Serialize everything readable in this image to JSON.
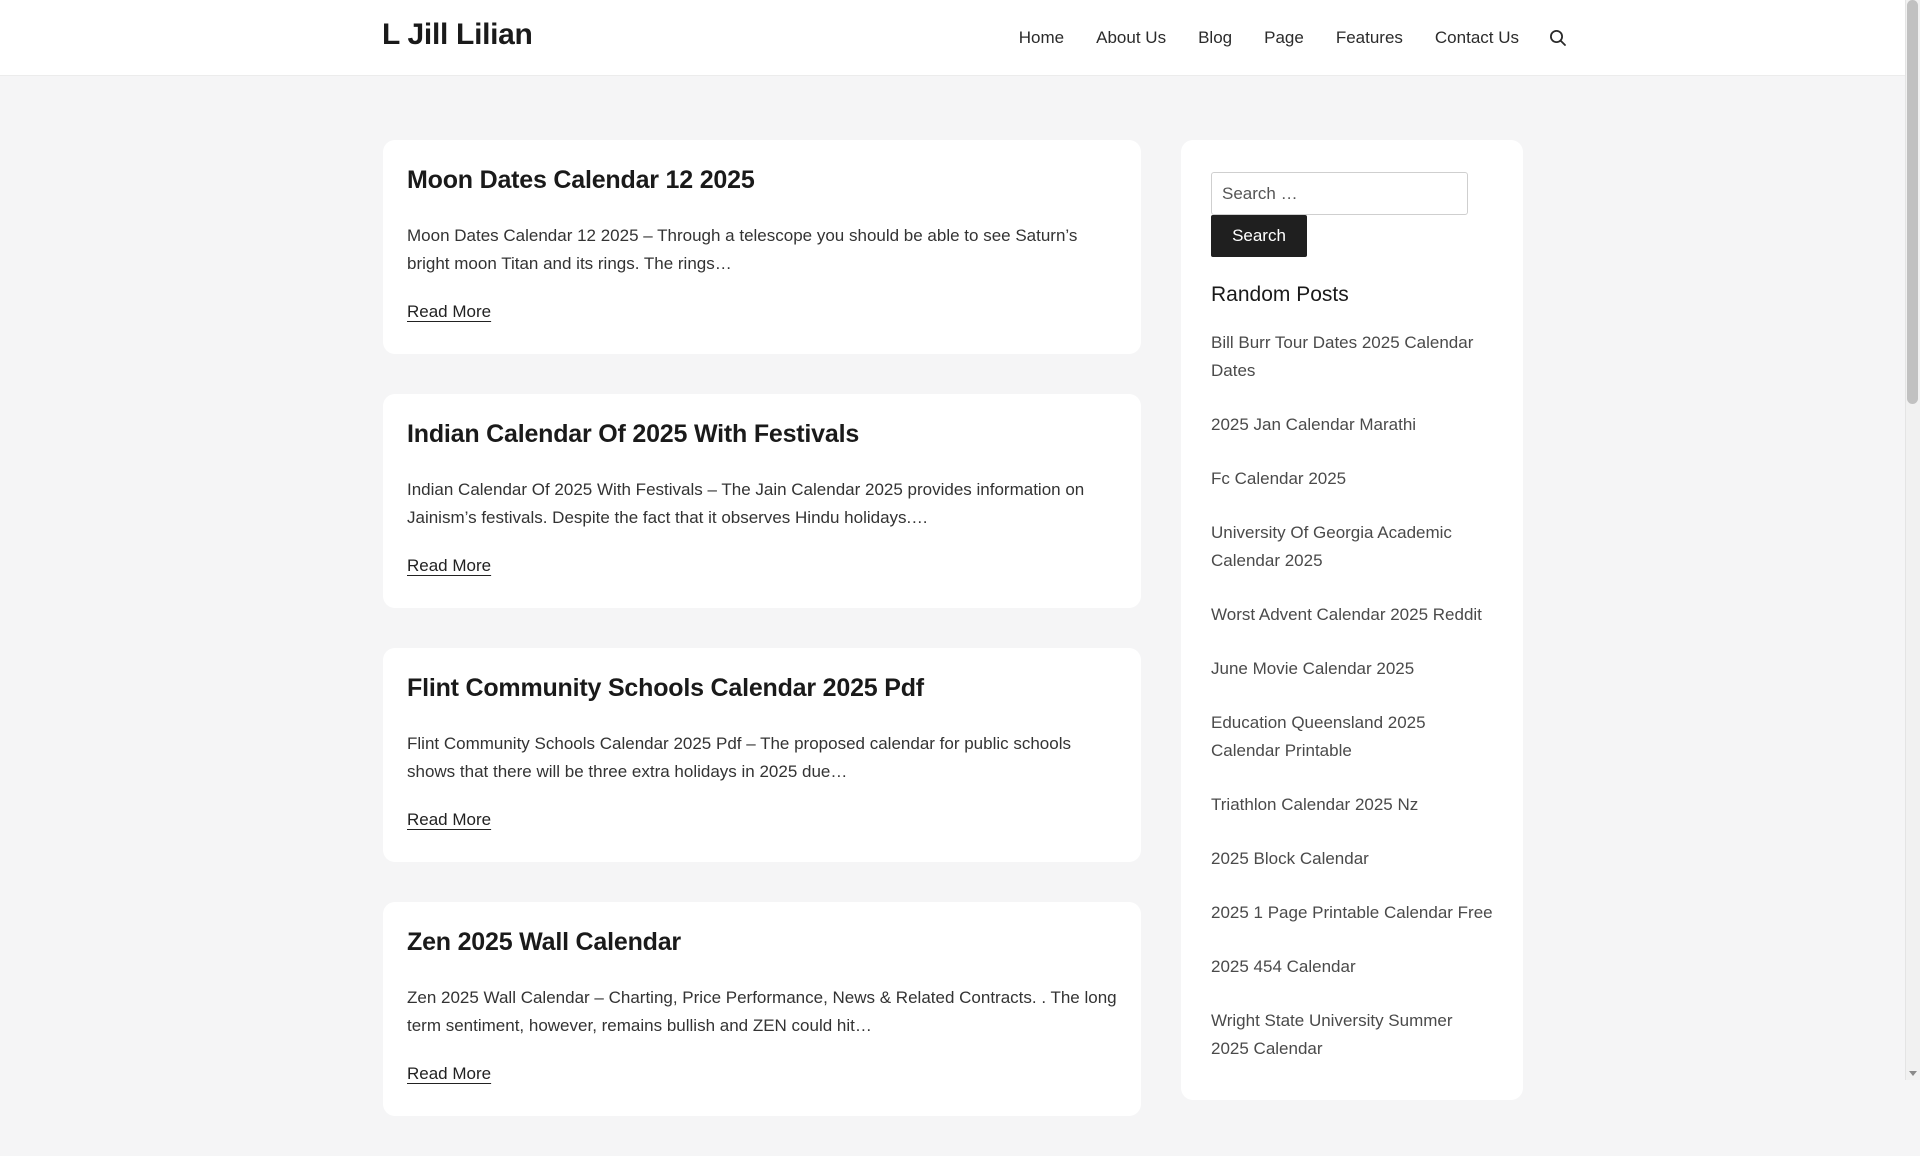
{
  "header": {
    "site_title": "L Jill Lilian",
    "nav": [
      "Home",
      "About Us",
      "Blog",
      "Page",
      "Features",
      "Contact Us"
    ]
  },
  "posts": [
    {
      "title": "Moon Dates Calendar 12 2025",
      "excerpt": "Moon Dates Calendar 12 2025 – Through a telescope you should be able to see Saturn’s bright moon Titan and its rings. The rings…",
      "read_more": "Read More"
    },
    {
      "title": "Indian Calendar Of 2025 With Festivals",
      "excerpt": "Indian Calendar Of 2025 With Festivals – The Jain Calendar 2025 provides information on Jainism’s festivals. Despite the fact that it observes Hindu holidays.…",
      "read_more": "Read More"
    },
    {
      "title": "Flint Community Schools Calendar 2025 Pdf",
      "excerpt": "Flint Community Schools Calendar 2025 Pdf – The proposed calendar for public schools shows that there will be three extra holidays in 2025 due…",
      "read_more": "Read More"
    },
    {
      "title": "Zen 2025 Wall Calendar",
      "excerpt": "Zen 2025 Wall Calendar – Charting, Price Performance, News & Related Contracts. . The long term sentiment, however, remains bullish and ZEN could hit…",
      "read_more": "Read More"
    }
  ],
  "sidebar": {
    "search_placeholder": "Search …",
    "search_button": "Search",
    "random_posts_title": "Random Posts",
    "random_posts": [
      "Bill Burr Tour Dates 2025 Calendar Dates",
      "2025 Jan Calendar Marathi",
      "Fc Calendar 2025",
      "University Of Georgia Academic Calendar 2025",
      "Worst Advent Calendar 2025 Reddit",
      "June Movie Calendar 2025",
      "Education Queensland 2025 Calendar Printable",
      "Triathlon Calendar 2025 Nz",
      "2025 Block Calendar",
      "2025 1 Page Printable Calendar Free",
      "2025 454 Calendar",
      "Wright State University Summer 2025 Calendar"
    ]
  },
  "icons": {
    "header_search": "search-icon"
  }
}
